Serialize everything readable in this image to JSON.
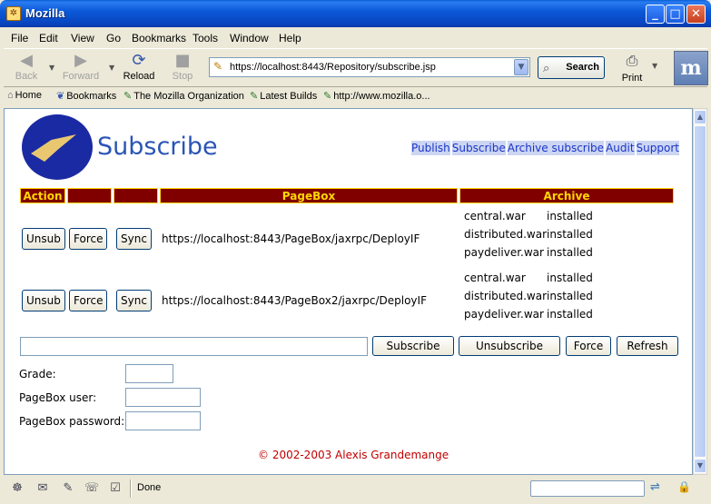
{
  "window": {
    "title": "Mozilla",
    "minimize_glyph": "_",
    "maximize_glyph": "□",
    "close_glyph": "✕"
  },
  "menu": [
    "File",
    "Edit",
    "View",
    "Go",
    "Bookmarks",
    "Tools",
    "Window",
    "Help"
  ],
  "toolbar": {
    "back_label": "Back",
    "forward_label": "Forward",
    "reload_label": "Reload",
    "stop_label": "Stop",
    "url": "https://localhost:8443/Repository/subscribe.jsp",
    "search_label": "Search",
    "print_label": "Print",
    "logo_glyph": "m"
  },
  "personal_toolbar": [
    "Home",
    "Bookmarks",
    "The Mozilla Organization",
    "Latest Builds",
    "http://www.mozilla.o..."
  ],
  "page": {
    "title": "Subscribe",
    "links": [
      "Publish",
      "Subscribe",
      "Archive subscribe",
      "Audit",
      "Support"
    ],
    "table_headers": {
      "action": "Action",
      "pagebox": "PageBox",
      "archive": "Archive"
    },
    "rows": [
      {
        "buttons": [
          "Unsub",
          "Force",
          "Sync"
        ],
        "pagebox_url": "https://localhost:8443/PageBox/jaxrpc/DeployIF",
        "archives": [
          {
            "name": "central.war",
            "status": "installed"
          },
          {
            "name": "distributed.war",
            "status": "installed"
          },
          {
            "name": "paydeliver.war",
            "status": "installed"
          }
        ]
      },
      {
        "buttons": [
          "Unsub",
          "Force",
          "Sync"
        ],
        "pagebox_url": "https://localhost:8443/PageBox2/jaxrpc/DeployIF",
        "archives": [
          {
            "name": "central.war",
            "status": "installed"
          },
          {
            "name": "distributed.war",
            "status": "installed"
          },
          {
            "name": "paydeliver.war",
            "status": "installed"
          }
        ]
      }
    ],
    "bottom_input_value": "",
    "bottom_buttons": [
      "Subscribe",
      "Unsubscribe",
      "Force",
      "Refresh"
    ],
    "fields": {
      "grade_label": "Grade:",
      "grade_value": "",
      "user_label": "PageBox user:",
      "user_value": "",
      "password_label": "PageBox password:",
      "password_value": ""
    },
    "copyright": "© 2002-2003 Alexis Grandemange"
  },
  "status": {
    "text": "Done"
  },
  "colors": {
    "header_bg": "#800000",
    "header_text": "#ffd700",
    "title": "#2a55b5",
    "link": "#1a34c8",
    "copyright": "#c00000"
  }
}
